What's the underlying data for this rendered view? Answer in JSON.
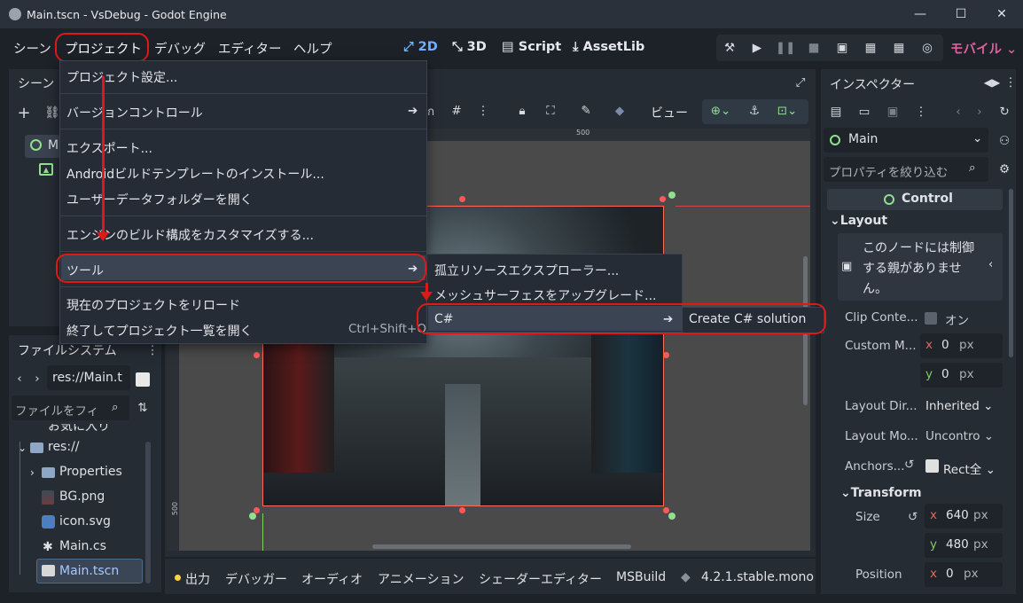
{
  "window": {
    "title": "Main.tscn - VsDebug - Godot Engine",
    "minimize": "—",
    "maximize": "☐",
    "close": "✕"
  },
  "menubar": {
    "items": [
      "シーン",
      "プロジェクト",
      "デバッグ",
      "エディター",
      "ヘルプ"
    ],
    "modes": [
      "2D",
      "3D",
      "Script",
      "AssetLib"
    ],
    "renderer": "モバイル"
  },
  "scene_dock": {
    "tab": "シーン",
    "root": "Ma"
  },
  "fs_dock": {
    "title": "ファイルシステム",
    "path": "res://Main.t",
    "filter_placeholder": "ファイルをフィ",
    "fav": "お気に入り",
    "items": [
      "res://",
      "Properties",
      "BG.png",
      "icon.svg",
      "Main.cs",
      "Main.tscn"
    ]
  },
  "viewport": {
    "view_label": "ビュー",
    "ruler_top": "500",
    "ruler_left": "500"
  },
  "project_menu": {
    "items": [
      "プロジェクト設定...",
      "バージョンコントロール",
      "エクスポート...",
      "Androidビルドテンプレートのインストール...",
      "ユーザーデータフォルダーを開く",
      "エンジンのビルド構成をカスタマイズする...",
      "ツール",
      "現在のプロジェクトをリロード",
      "終了してプロジェクト一覧を開く"
    ],
    "shortcut": "Ctrl+Shift+Q"
  },
  "tools_menu": {
    "items": [
      "孤立リソースエクスプローラー...",
      "メッシュサーフェスをアップグレード...",
      "C#"
    ]
  },
  "csharp_menu": {
    "items": [
      "Create C# solution"
    ]
  },
  "inspector": {
    "title": "インスペクター",
    "node": "Main",
    "filter": "プロパティを絞り込む",
    "class": "Control",
    "layout": "Layout",
    "warning": "このノードには制御する親がありません。",
    "clip": "Clip Conte...",
    "clip_val": "オン",
    "custom_min": "Custom M...",
    "x": "x",
    "y": "y",
    "zero": "0",
    "px": "px",
    "layout_dir": "Layout Dir...",
    "layout_dir_val": "Inherited",
    "layout_mode": "Layout Mo...",
    "layout_mode_val": "Uncontro",
    "anchors": "Anchors...",
    "anchors_val": "Rect全",
    "transform": "Transform",
    "size": "Size",
    "size_x": "640",
    "size_y": "480",
    "position": "Position",
    "pos_x": "0"
  },
  "bottom": {
    "tabs": [
      "出力",
      "デバッガー",
      "オーディオ",
      "アニメーション",
      "シェーダーエディター",
      "MSBuild"
    ],
    "version": "4.2.1.stable.mono"
  }
}
